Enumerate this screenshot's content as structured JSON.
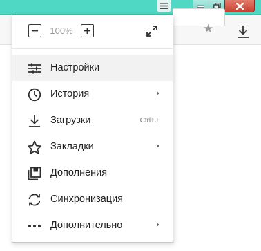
{
  "window": {
    "accent": "#4fd9c5"
  },
  "menu": {
    "zoom": {
      "value": "100%"
    },
    "items": [
      {
        "label": "Настройки",
        "icon": "settings-sliders-icon",
        "active": true
      },
      {
        "label": "История",
        "icon": "clock-icon",
        "submenu": true
      },
      {
        "label": "Загрузки",
        "icon": "download-icon",
        "shortcut": "Ctrl+J"
      },
      {
        "label": "Закладки",
        "icon": "star-icon",
        "submenu": true
      },
      {
        "label": "Дополнения",
        "icon": "extensions-icon"
      },
      {
        "label": "Синхронизация",
        "icon": "sync-icon"
      },
      {
        "label": "Дополнительно",
        "icon": "more-dots-icon",
        "submenu": true
      }
    ]
  },
  "toolbar": {
    "bookmark_glyph": "★"
  }
}
